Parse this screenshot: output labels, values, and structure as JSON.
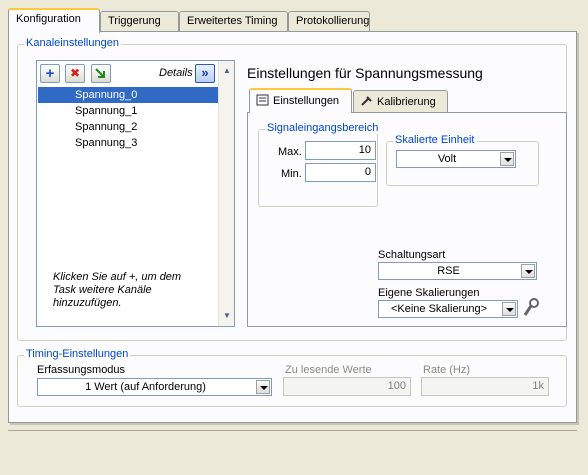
{
  "tabs": [
    {
      "label": "Konfiguration",
      "active": true
    },
    {
      "label": "Triggerung",
      "active": false
    },
    {
      "label": "Erweitertes Timing",
      "active": false
    },
    {
      "label": "Protokollierung",
      "active": false
    }
  ],
  "channel_settings": {
    "group_title": "Kanaleinstellungen",
    "details_label": "Details",
    "details_button": "»",
    "add_button": "+",
    "remove_button": "✖",
    "channels": [
      "Spannung_0",
      "Spannung_1",
      "Spannung_2",
      "Spannung_3"
    ],
    "selected_channel": "Spannung_0",
    "hint": "Klicken Sie auf +, um dem Task weitere Kanäle hinzuzufügen."
  },
  "voltage_settings": {
    "title": "Einstellungen für Spannungsmessung",
    "tabs": [
      {
        "label": "Einstellungen",
        "active": true
      },
      {
        "label": "Kalibrierung",
        "active": false
      }
    ],
    "signal_range": {
      "title": "Signaleingangsbereich",
      "max_label": "Max.",
      "max_value": "10",
      "min_label": "Min.",
      "min_value": "0"
    },
    "scaled_unit": {
      "title": "Skalierte Einheit",
      "value": "Volt"
    },
    "terminal_config": {
      "label": "Schaltungsart",
      "value": "RSE"
    },
    "custom_scaling": {
      "label": "Eigene Skalierungen",
      "value": "<Keine Skalierung>"
    }
  },
  "timing": {
    "group_title": "Timing-Einstellungen",
    "acquisition_mode_label": "Erfassungsmodus",
    "acquisition_mode_value": "1 Wert (auf Anforderung)",
    "samples_label": "Zu lesende Werte",
    "samples_value": "100",
    "rate_label": "Rate (Hz)",
    "rate_value": "1k"
  }
}
